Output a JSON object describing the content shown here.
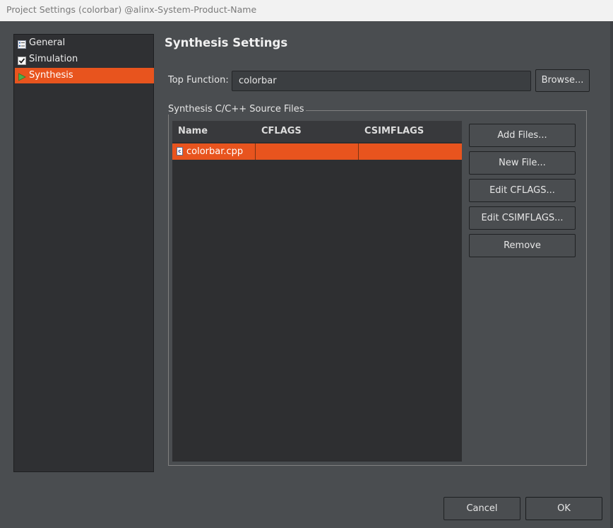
{
  "window": {
    "title": "Project Settings (colorbar) @alinx-System-Product-Name"
  },
  "sidebar": {
    "items": [
      {
        "label": "General",
        "icon": "general-settings-icon"
      },
      {
        "label": "Simulation",
        "icon": "checkbox-checked-icon"
      },
      {
        "label": "Synthesis",
        "icon": "play-arrow-icon",
        "selected": true
      }
    ]
  },
  "main": {
    "heading": "Synthesis Settings",
    "top_function": {
      "label": "Top Function:",
      "value": "colorbar",
      "browse_label": "Browse..."
    },
    "sources": {
      "group_title": "Synthesis C/C++ Source Files",
      "columns": [
        "Name",
        "CFLAGS",
        "CSIMFLAGS"
      ],
      "rows": [
        {
          "name": "colorbar.cpp",
          "cflags": "",
          "csimflags": "",
          "icon": "cpp-file-icon",
          "icon_letter": "c"
        }
      ],
      "buttons": [
        "Add Files...",
        "New File...",
        "Edit CFLAGS...",
        "Edit CSIMFLAGS...",
        "Remove"
      ]
    }
  },
  "footer": {
    "cancel_label": "Cancel",
    "ok_label": "OK"
  },
  "colors": {
    "accent": "#e8541e",
    "background": "#4a4d50",
    "panel": "#2f3033"
  }
}
